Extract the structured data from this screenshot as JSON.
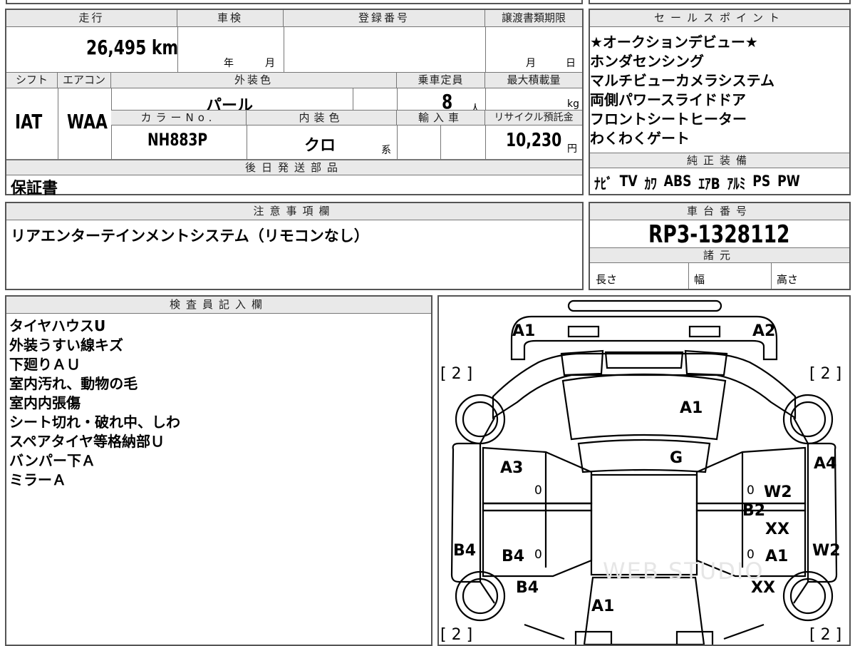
{
  "main": {
    "mileage_label": "走行",
    "mileage_value": "26,495 km",
    "inspection_label": "車検",
    "inspection_year": "年",
    "inspection_month": "月",
    "registration_label": "登録番号",
    "transfer_label": "譲渡書類期限",
    "transfer_month": "月",
    "transfer_day": "日",
    "shift_label": "シフト",
    "shift_value": "IAT",
    "ac_label": "エアコン",
    "ac_value": "WAA",
    "exterior_label": "外装色",
    "exterior_value": "パール",
    "capacity_label": "乗車定員",
    "capacity_value": "8",
    "capacity_unit": "人",
    "load_label": "最大積載量",
    "load_unit": "kg",
    "color_no_label": "カラーNo.",
    "color_no_value": "NH883P",
    "interior_label": "内装色",
    "interior_value": "クロ",
    "interior_suffix": "系",
    "import_label": "輸入車",
    "recycle_label": "リサイクル預託金",
    "recycle_value": "10,230",
    "recycle_unit": "円",
    "later_label": "後日発送部品",
    "later_value": "保証書"
  },
  "sales": {
    "title": "セールスポイント",
    "items": [
      "★オークションデビュー★",
      "ホンダセンシング",
      "マルチビューカメラシステム",
      "両側パワースライドドア",
      "フロントシートヒーター",
      "わくわくゲート"
    ]
  },
  "equipment": {
    "title": "純正装備",
    "items": [
      "ﾅﾋﾞ",
      "TV",
      "ｶﾜ",
      "ABS",
      "ｴｱB",
      "ｱﾙﾐ",
      "PS",
      "PW"
    ]
  },
  "notes": {
    "title": "注意事項欄",
    "text": "リアエンターテインメントシステム（リモコンなし）"
  },
  "chassis": {
    "title": "車台番号",
    "value": "RP3-1328112",
    "spec_title": "諸元",
    "length_label": "長さ",
    "width_label": "幅",
    "height_label": "高さ"
  },
  "inspector": {
    "title": "検査員記入欄",
    "items": [
      "タイヤハウスU",
      "外装うすい線キズ",
      "下廻りＡＵ",
      "室内汚れ、動物の毛",
      "室内内張傷",
      "シート切れ・破れ中、しわ",
      "スペアタイヤ等格納部Ｕ",
      "バンパー下Ａ",
      "ミラーＡ"
    ]
  },
  "diagram": {
    "marks": [
      "A1",
      "A2",
      "A1",
      "G",
      "A3",
      "A4",
      "W2",
      "B2",
      "XX",
      "B4",
      "B4",
      "A1",
      "W2",
      "B4",
      "XX",
      "A1"
    ],
    "tire_left_top": "[ 2 ]",
    "tire_right_top": "[ 2 ]",
    "tire_left_bottom": "[ 2 ]",
    "tire_right_bottom": "[ 2 ]",
    "zero_marks": [
      "0",
      "0",
      "0",
      "0"
    ],
    "watermark": "WEB STUDIO"
  }
}
